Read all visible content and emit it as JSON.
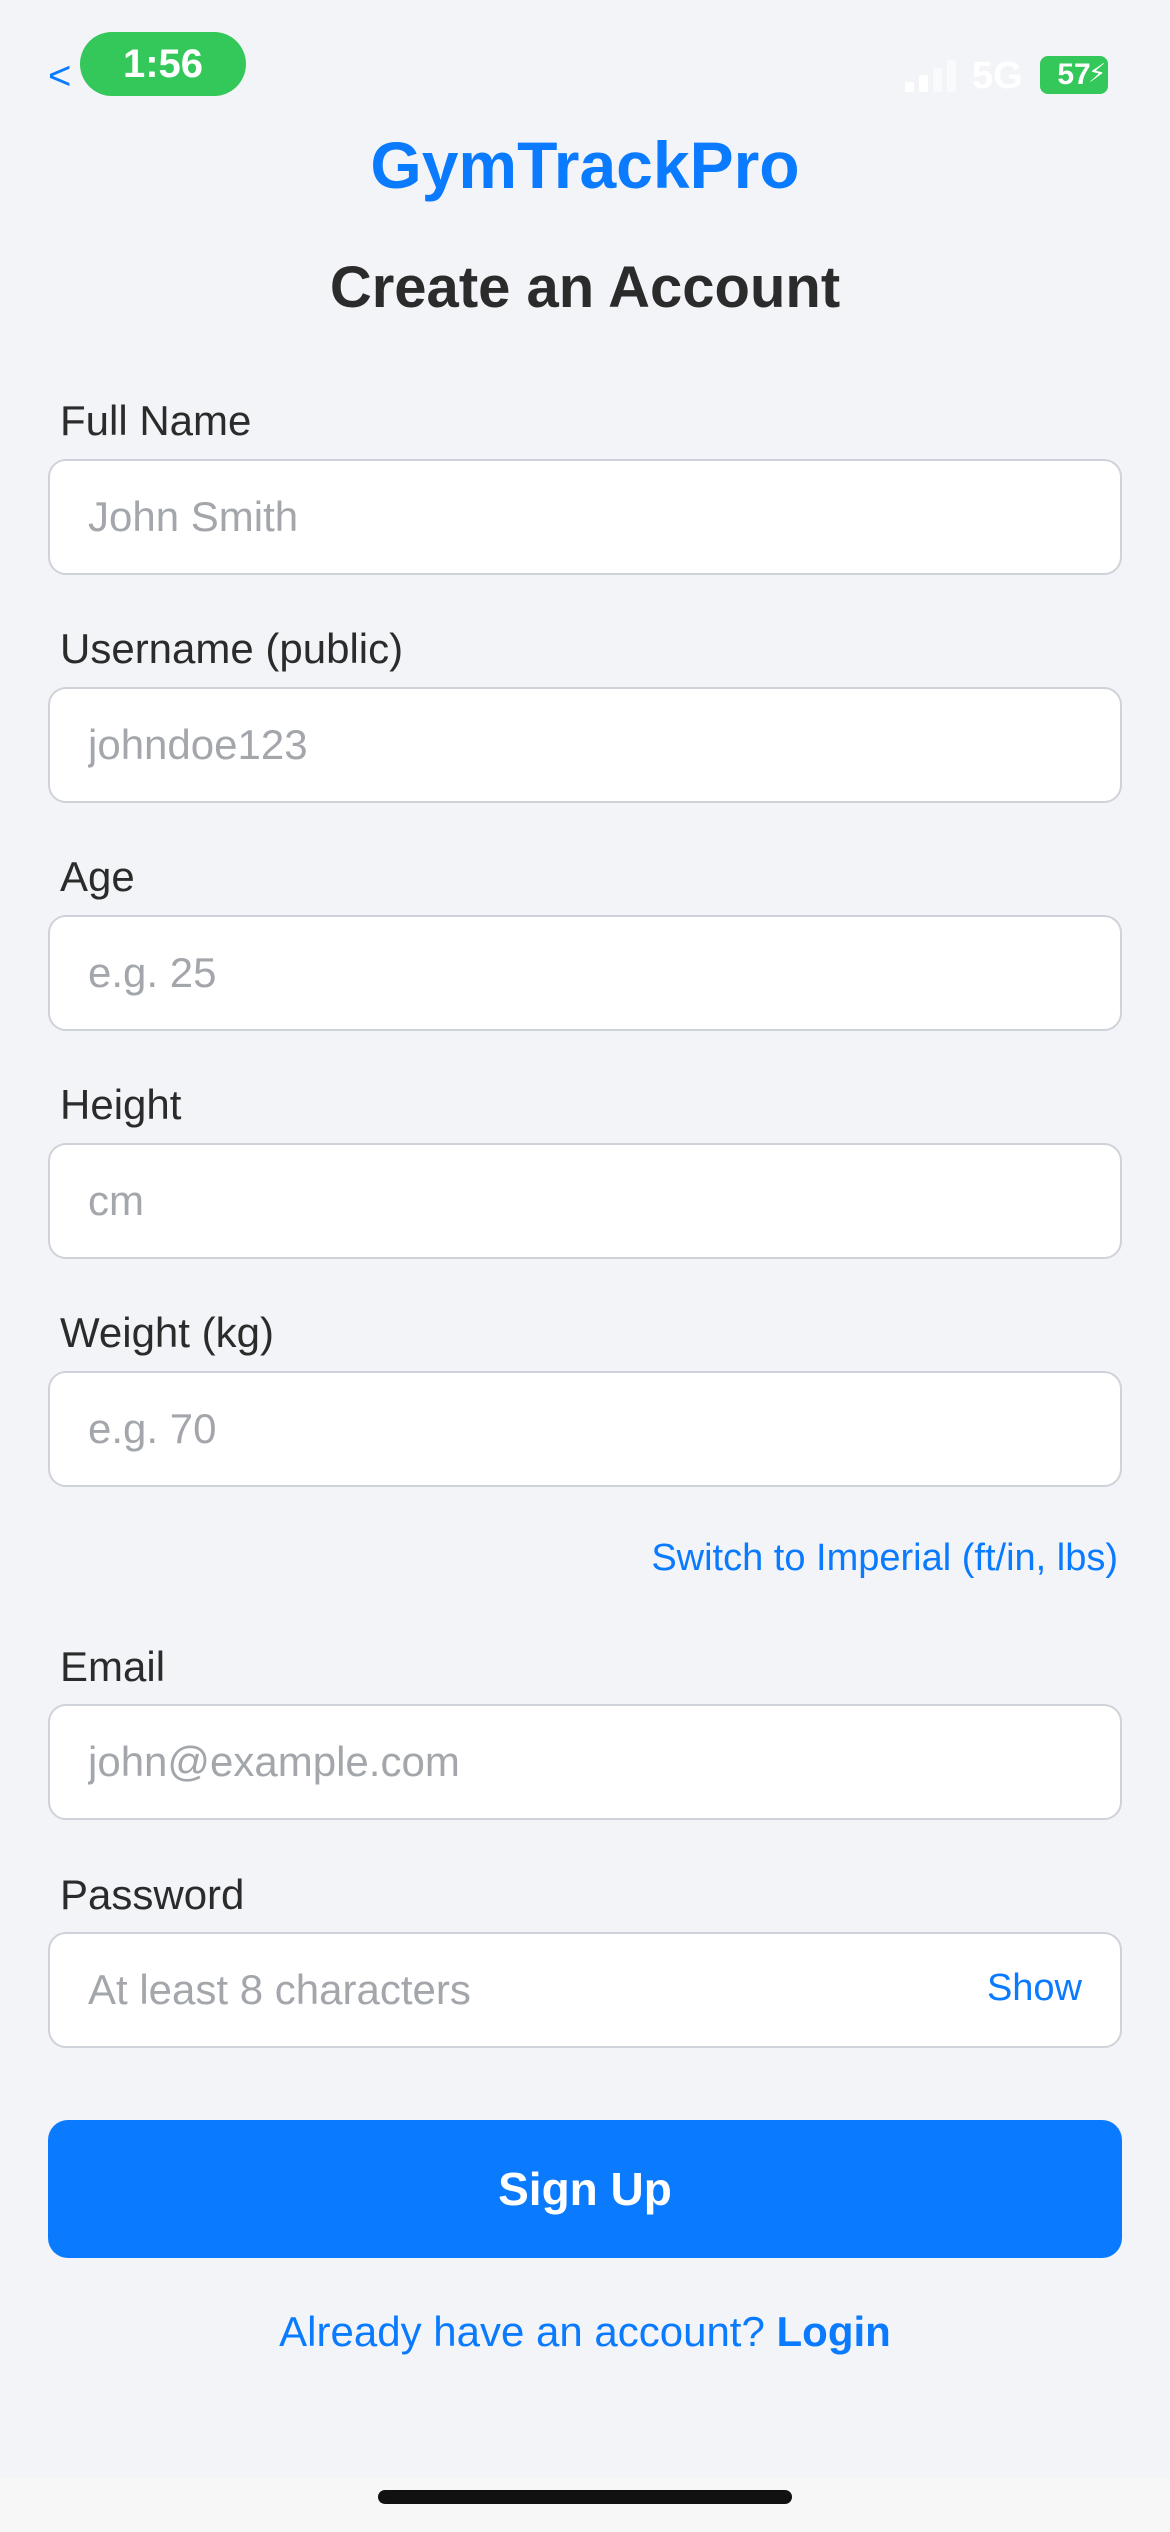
{
  "status_bar": {
    "back": "<",
    "time": "1:56",
    "network": "5G",
    "battery": "57",
    "colors": {
      "pill": "#34c759"
    }
  },
  "app_title": "GymTrackPro",
  "page_title": "Create an Account",
  "form": {
    "full_name": {
      "label": "Full Name",
      "placeholder": "John Smith",
      "value": ""
    },
    "username": {
      "label": "Username (public)",
      "placeholder": "johndoe123",
      "value": ""
    },
    "age": {
      "label": "Age",
      "placeholder": "e.g. 25",
      "value": ""
    },
    "height": {
      "label": "Height",
      "placeholder": "cm",
      "value": ""
    },
    "weight": {
      "label": "Weight (kg)",
      "placeholder": "e.g. 70",
      "value": ""
    },
    "unit_switch": "Switch to Imperial (ft/in, lbs)",
    "email": {
      "label": "Email",
      "placeholder": "john@example.com",
      "value": ""
    },
    "password": {
      "label": "Password",
      "placeholder": "At least 8 characters",
      "value": "",
      "toggle": "Show"
    }
  },
  "signup_button": "Sign Up",
  "login_prompt": {
    "text": "Already have an account?",
    "link": "Login"
  },
  "colors": {
    "accent": "#0a7aff",
    "background": "#f2f4f7"
  }
}
